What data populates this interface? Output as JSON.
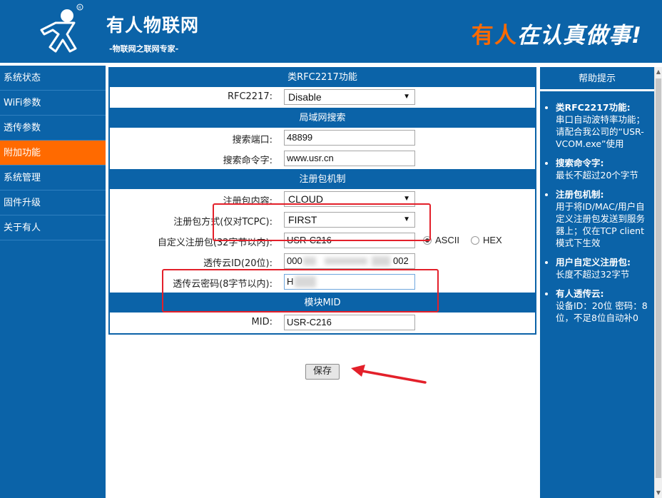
{
  "header": {
    "brand_name": "有人物联网",
    "brand_sub": "-物联网之联网专家-",
    "slogan_highlight": "有人",
    "slogan_rest": "在认真做事!"
  },
  "sidebar": {
    "items": [
      {
        "label": "系统状态"
      },
      {
        "label": "WiFi参数"
      },
      {
        "label": "透传参数"
      },
      {
        "label": "附加功能",
        "active": true
      },
      {
        "label": "系统管理"
      },
      {
        "label": "固件升级"
      },
      {
        "label": "关于有人"
      }
    ]
  },
  "rfc": {
    "title": "类RFC2217功能",
    "label": "RFC2217:",
    "value": "Disable"
  },
  "lan": {
    "title": "局域网搜索",
    "port_label": "搜索端口:",
    "port_value": "48899",
    "cmd_label": "搜索命令字:",
    "cmd_value": "www.usr.cn"
  },
  "reg": {
    "title": "注册包机制",
    "content_label": "注册包内容:",
    "content_value": "CLOUD",
    "mode_label": "注册包方式(仅对TCPC):",
    "mode_value": "FIRST",
    "custom_label": "自定义注册包(32字节以内):",
    "custom_value": "USR-C216",
    "ascii_label": "ASCII",
    "hex_label": "HEX",
    "cloud_id_label": "透传云ID(20位):",
    "cloud_id_prefix": "000",
    "cloud_id_suffix": "002",
    "cloud_pwd_label": "透传云密码(8字节以内):",
    "cloud_pwd_value": "H"
  },
  "mid": {
    "title": "模块MID",
    "label": "MID:",
    "value": "USR-C216"
  },
  "save_label": "保存",
  "help": {
    "title": "帮助提示",
    "items": [
      {
        "head": "类RFC2217功能:",
        "body": "串口自动波特率功能；请配合我公司的“USR-VCOM.exe”使用"
      },
      {
        "head": "搜索命令字:",
        "body": "最长不超过20个字节"
      },
      {
        "head": "注册包机制:",
        "body": "用于将ID/MAC/用户自定义注册包发送到服务器上；仅在TCP client模式下生效"
      },
      {
        "head": "用户自定义注册包:",
        "body": "长度不超过32字节"
      },
      {
        "head": "有人透传云:",
        "body": "设备ID：20位 密码：8位，不足8位自动补0"
      }
    ]
  },
  "colors": {
    "brand_blue": "#0b63a8",
    "accent_orange": "#ff6a00",
    "highlight_red": "#e3202a"
  }
}
